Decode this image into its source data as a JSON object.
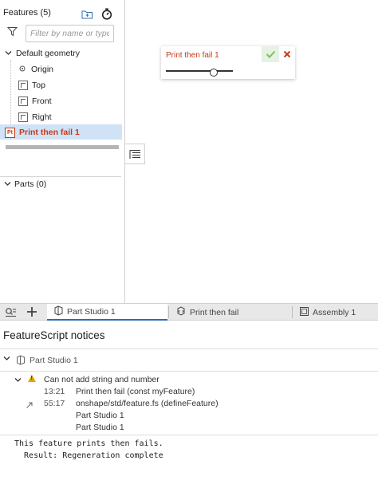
{
  "feature_panel": {
    "title": "Features (5)",
    "filter_placeholder": "Filter by name or type",
    "default_geometry": "Default geometry",
    "origin": "Origin",
    "planes": [
      "Top",
      "Front",
      "Right"
    ],
    "selected_feature": "Print then fail 1",
    "feature_badge": "Pt",
    "parts": "Parts (0)"
  },
  "dialog": {
    "title": "Print then fail 1",
    "slider_value": 0.72
  },
  "tabs": [
    {
      "label": "Part Studio 1",
      "active": true
    },
    {
      "label": "Print then fail",
      "active": false
    },
    {
      "label": "Assembly 1",
      "active": false
    }
  ],
  "notices": {
    "title": "FeatureScript notices",
    "group": "Part Studio 1",
    "error": "Can not add string and number",
    "trace": [
      {
        "line": "13:21",
        "text": "Print then fail (const myFeature)"
      },
      {
        "line": "55:17",
        "text": "onshape/std/feature.fs (defineFeature)"
      }
    ],
    "trace_extra": [
      "Part Studio 1",
      "Part Studio 1"
    ],
    "console": [
      "This feature prints then fails.",
      "  Result: Regeneration complete"
    ]
  },
  "colors": {
    "accent": "#2c6db3",
    "error": "#c63b1a",
    "selected": "#cfe2f6"
  }
}
